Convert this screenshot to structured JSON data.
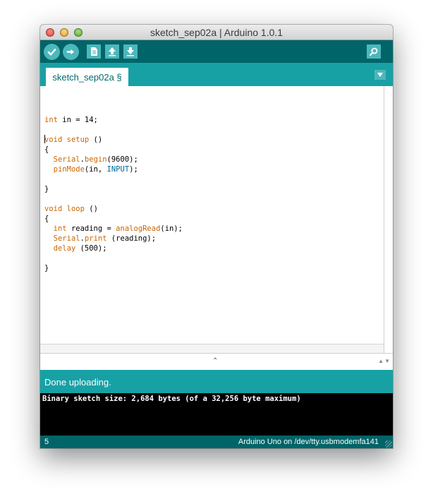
{
  "window": {
    "title": "sketch_sep02a | Arduino 1.0.1"
  },
  "toolbar": {
    "buttons": [
      "verify-icon",
      "upload-icon",
      "new-icon",
      "open-icon",
      "save-icon"
    ],
    "search": "serial-monitor-icon"
  },
  "tabs": [
    {
      "label": "sketch_sep02a §"
    }
  ],
  "editor": {
    "lines": [
      "",
      "int in = 14;",
      "",
      "void setup ()",
      "{",
      "  Serial.begin(9600);",
      "  pinMode(in, INPUT);",
      "",
      "}",
      "",
      "void loop ()",
      "{",
      "  int reading = analogRead(in);",
      "  Serial.print (reading);",
      "  delay (500);",
      "",
      "}"
    ]
  },
  "status": {
    "message": "Done uploading."
  },
  "console": {
    "text": "Binary sketch size: 2,684 bytes (of a 32,256 byte maximum)"
  },
  "footer": {
    "line": "5",
    "board": "Arduino Uno on /dev/tty.usbmodemfa141"
  },
  "colors": {
    "toolbar_bg": "#006468",
    "tab_bar_bg": "#17a1a5",
    "button_bg": "#4db7bb",
    "keyword": "#cc6600",
    "constant": "#006699"
  }
}
